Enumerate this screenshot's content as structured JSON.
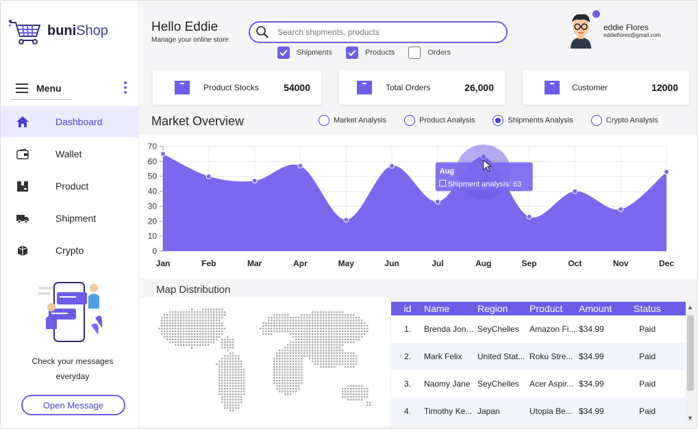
{
  "brand": {
    "name_part1": "buni",
    "name_part2": "Shop"
  },
  "sidebar": {
    "menu_label": "Menu",
    "items": [
      {
        "label": "Dashboard",
        "icon": "home-icon",
        "active": true
      },
      {
        "label": "Wallet",
        "icon": "wallet-icon",
        "active": false
      },
      {
        "label": "Product",
        "icon": "product-icon",
        "active": false
      },
      {
        "label": "Shipment",
        "icon": "truck-icon",
        "active": false
      },
      {
        "label": "Crypto",
        "icon": "crypto-icon",
        "active": false
      }
    ],
    "promo_text_line1": "Check your messages",
    "promo_text_line2": "everyday",
    "open_message_label": "Open Message"
  },
  "header": {
    "greeting": "Hello Eddie",
    "subtitle": "Manage your online store",
    "search_placeholder": "Search shipments, products",
    "filters": [
      {
        "label": "Shipments",
        "checked": true
      },
      {
        "label": "Products",
        "checked": true
      },
      {
        "label": "Orders",
        "checked": false
      }
    ],
    "user": {
      "name": "eddie Flores",
      "email": "eddieflores@gmail.com"
    }
  },
  "stats": [
    {
      "label": "Product Stocks",
      "value": "54000"
    },
    {
      "label": "Total Orders",
      "value": "26,000"
    },
    {
      "label": "Customer",
      "value": "12000"
    }
  ],
  "market": {
    "title": "Market Overview",
    "options": [
      {
        "label": "Market Analysis",
        "selected": false
      },
      {
        "label": "Product Analysis",
        "selected": false
      },
      {
        "label": "Shipments Analysis",
        "selected": true
      },
      {
        "label": "Crypto Analysis",
        "selected": false
      }
    ],
    "tooltip": {
      "title": "Aug",
      "text": "Shipment analysis: 63"
    }
  },
  "chart_data": {
    "type": "area",
    "categories": [
      "Jan",
      "Feb",
      "Mar",
      "Apr",
      "May",
      "Jun",
      "Jul",
      "Aug",
      "Sep",
      "Oct",
      "Nov",
      "Dec"
    ],
    "series": [
      {
        "name": "Shipment analysis",
        "values": [
          65,
          50,
          47,
          57,
          21,
          57,
          33,
          63,
          23,
          40,
          28,
          53
        ],
        "color": "#7b68ee"
      }
    ],
    "yticks": [
      0,
      10,
      20,
      30,
      40,
      50,
      60,
      70
    ],
    "ylim": [
      0,
      70
    ],
    "grid": true
  },
  "map": {
    "title": "Map Distribution"
  },
  "table": {
    "columns": [
      "id",
      "Name",
      "Region",
      "Product",
      "Amount",
      "Status"
    ],
    "rows": [
      [
        "1.",
        "Brenda Jones",
        "SeyChelles",
        "Amazon Fi...",
        "$34.99",
        "Paid"
      ],
      [
        "2.",
        "Mark Felix",
        "United Stat...",
        "Roku Stre...",
        "$34.99",
        "Paid"
      ],
      [
        "3.",
        "Naomy Jane",
        "SeyChelles",
        "Acer Aspir...",
        "$34.99",
        "Paid"
      ],
      [
        "4.",
        "Timothy Ke...",
        "Japan",
        "Utopia Be...",
        "$34.99",
        "Paid"
      ]
    ]
  },
  "colors": {
    "accent": "#6c5ce7",
    "accent_dark": "#4b3fd6",
    "active_bg": "#ecebfd"
  }
}
